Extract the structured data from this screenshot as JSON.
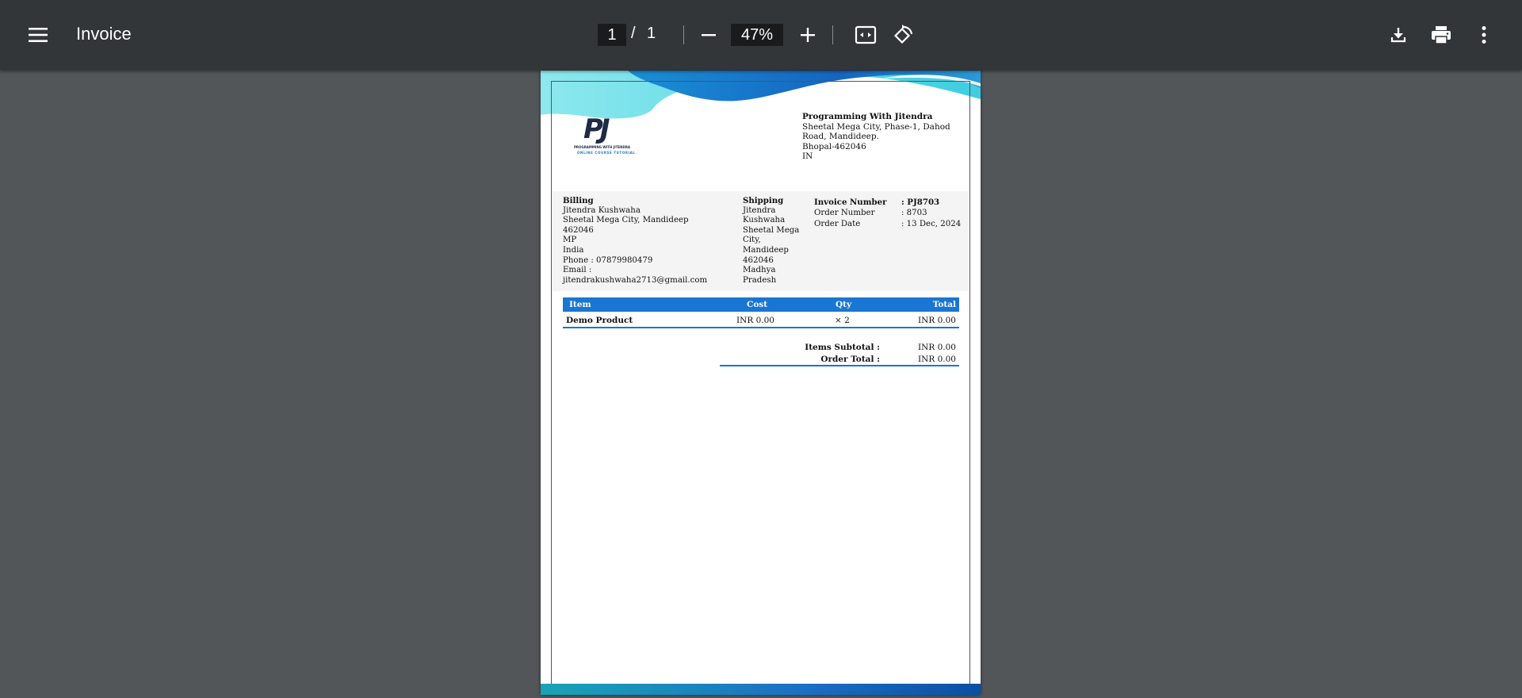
{
  "toolbar": {
    "title": "Invoice",
    "page_current": "1",
    "page_separator": "/",
    "page_total": "1",
    "zoom": "47%"
  },
  "company": {
    "name": "Programming With Jitendra",
    "address_lines": [
      "Sheetal Mega City, Phase-1, Dahod",
      "Road, Mandideep.",
      "Bhopal-462046",
      "IN"
    ],
    "logo_text": "PJ",
    "logo_sub1": "PROGRAMMING WITH JITENDRA",
    "logo_sub2": "ONLINE COURSE TUTORIAL"
  },
  "billing": {
    "heading": "Billing",
    "lines": [
      "Jitendra Kushwaha",
      "Sheetal Mega City, Mandideep",
      "462046",
      "MP",
      "India",
      "Phone : 07879980479",
      "Email :",
      "jitendrakushwaha2713@gmail.com"
    ]
  },
  "shipping": {
    "heading": "Shipping",
    "lines": [
      "Jitendra",
      "Kushwaha",
      "Sheetal Mega",
      "City,",
      "Mandideep",
      "462046",
      "Madhya",
      "Pradesh"
    ]
  },
  "invoice": {
    "number_label": "Invoice Number",
    "number": ": PJ8703",
    "order_label": "Order Number",
    "order": ": 8703",
    "date_label": "Order Date",
    "date": ": 13 Dec, 2024"
  },
  "items": {
    "headers": [
      "Item",
      "Cost",
      "Qty",
      "Total"
    ],
    "rows": [
      {
        "item": "Demo Product",
        "cost": "INR 0.00",
        "qty": "× 2",
        "total": "INR 0.00"
      }
    ]
  },
  "totals": {
    "subtotal_label": "Items Subtotal :",
    "subtotal": "INR 0.00",
    "order_total_label": "Order Total :",
    "order_total": "INR 0.00"
  },
  "icons": [
    "menu-icon",
    "zoom-out-icon",
    "zoom-in-icon",
    "fit-to-page-icon",
    "rotate-icon",
    "download-icon",
    "print-icon",
    "more-icon"
  ],
  "colors": {
    "toolbar": "#323639",
    "viewer_bg": "#525659",
    "accent": "#1976d2"
  }
}
